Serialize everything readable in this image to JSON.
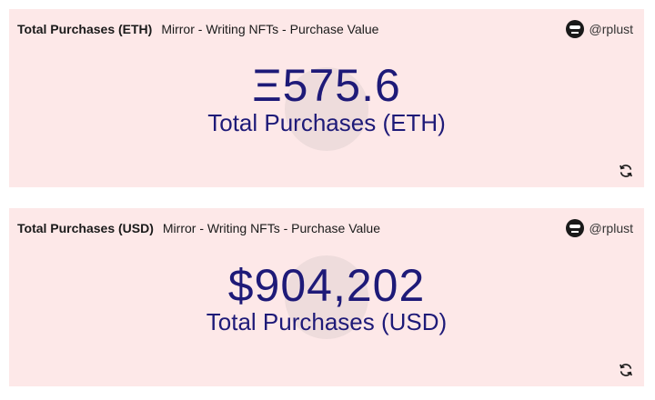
{
  "cards": [
    {
      "title": "Total Purchases (ETH)",
      "subtitle": "Mirror - Writing NFTs - Purchase Value",
      "user": "@rplust",
      "value": "Ξ575.6",
      "label": "Total Purchases (ETH)"
    },
    {
      "title": "Total Purchases (USD)",
      "subtitle": "Mirror - Writing NFTs - Purchase Value",
      "user": "@rplust",
      "value": "$904,202",
      "label": "Total Purchases (USD)"
    }
  ],
  "icons": {
    "avatar": "avatar-icon",
    "refresh": "refresh-icon"
  },
  "colors": {
    "card_background": "#fde8e8",
    "value_color": "#1e1a78"
  }
}
